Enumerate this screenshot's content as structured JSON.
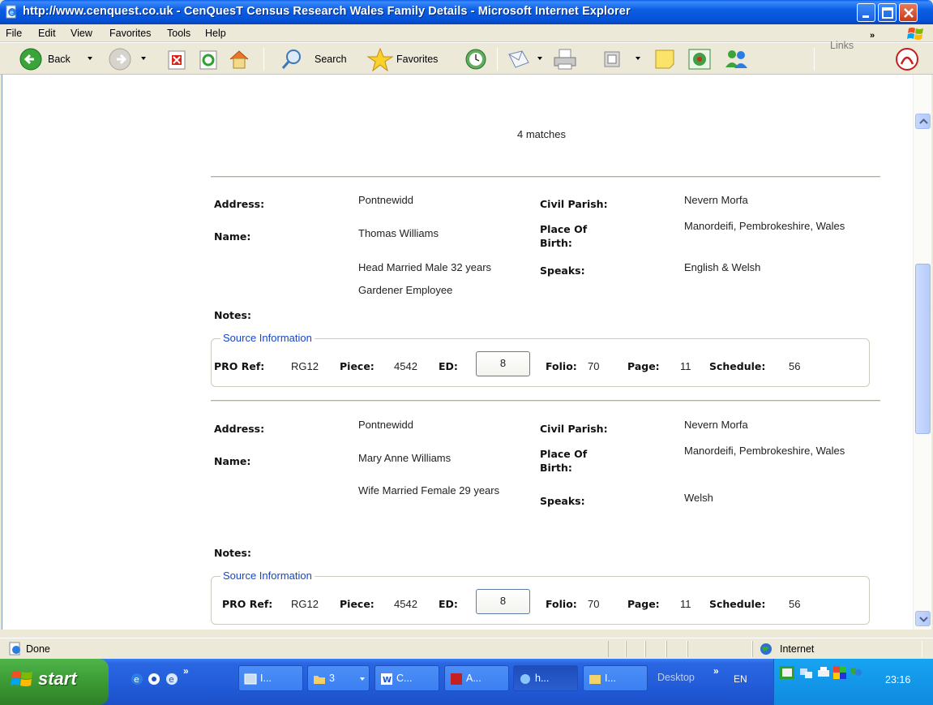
{
  "window": {
    "title": "http://www.cenquest.co.uk - CenQuesT Census Research Wales Family Details - Microsoft Internet Explorer"
  },
  "menu": [
    "File",
    "Edit",
    "View",
    "Favorites",
    "Tools",
    "Help"
  ],
  "toolbar": {
    "back_label": "Back",
    "search_label": "Search",
    "favorites_label": "Favorites",
    "links_label": "Links"
  },
  "page": {
    "matches": "4 matches",
    "labels": {
      "address": "Address:",
      "name": "Name:",
      "notes": "Notes:",
      "civil_parish": "Civil Parish:",
      "place_of_birth": "Place Of Birth:",
      "speaks": "Speaks:",
      "source_information": "Source Information",
      "pro_ref": "PRO Ref:",
      "piece": "Piece:",
      "ed": "ED:",
      "folio": "Folio:",
      "page": "Page:",
      "schedule": "Schedule:"
    },
    "records": [
      {
        "address": "Pontnewidd",
        "name": "Thomas Williams",
        "details": "Head Married Male 32 years",
        "occupation": "Gardener Employee",
        "notes": "",
        "civil_parish": "Nevern Morfa",
        "place_of_birth": "Manordeifi, Pembrokeshire, Wales",
        "speaks": "English & Welsh",
        "source": {
          "pro_ref": "RG12",
          "piece": "4542",
          "ed": "8",
          "folio": "70",
          "page": "11",
          "schedule": "56"
        }
      },
      {
        "address": "Pontnewidd",
        "name": "Mary Anne Williams",
        "details": "Wife Married Female 29 years",
        "occupation": "",
        "notes": "",
        "civil_parish": "Nevern Morfa",
        "place_of_birth": "Manordeifi, Pembrokeshire, Wales",
        "speaks": "Welsh",
        "source": {
          "pro_ref": "RG12",
          "piece": "4542",
          "ed": "8",
          "folio": "70",
          "page": "11",
          "schedule": "56"
        }
      }
    ]
  },
  "status": {
    "text": "Done",
    "zone": "Internet"
  },
  "taskbar": {
    "start_label": "start",
    "buttons": [
      "I...",
      "3",
      "C...",
      "A...",
      "h...",
      "I..."
    ],
    "desktop_label": "Desktop",
    "lang": "EN",
    "clock": "23:16"
  }
}
